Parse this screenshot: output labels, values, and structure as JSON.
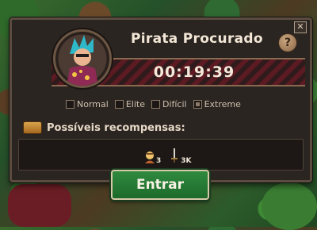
{
  "dialog": {
    "title": "Pirata Procurado",
    "timer": "00:19:39",
    "close_label": "✕",
    "help_label": "?"
  },
  "modes": [
    {
      "label": "Normal",
      "checked": false
    },
    {
      "label": "Elite",
      "checked": false
    },
    {
      "label": "Difícil",
      "checked": false
    },
    {
      "label": "Extreme",
      "checked": true
    }
  ],
  "rewards": {
    "label": "Possíveis recompensas:",
    "items": [
      {
        "icon": "character-token-icon",
        "count": "3"
      },
      {
        "icon": "sword-item-icon",
        "count": "3K"
      }
    ]
  },
  "action": {
    "enter_label": "Entrar"
  },
  "colors": {
    "panel": "#2b2521",
    "stripe_red": "#5c1a22",
    "button_green": "#2f8a3e"
  }
}
